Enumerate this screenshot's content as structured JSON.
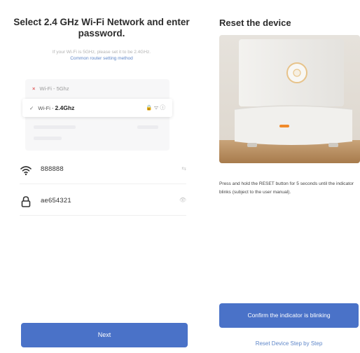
{
  "left": {
    "title": "Select 2.4 GHz Wi-Fi Network and enter password.",
    "hint": "If your Wi-Fi is 5GHz, please set it to be 2.4GHz.",
    "hint_link": "Common router setting method",
    "wifi_list": {
      "row_5g_mark": "×",
      "row_5g_label": "Wi-Fi - 5Ghz",
      "row_24_mark": "✓",
      "row_24_prefix": "Wi-Fi - ",
      "row_24_band": "2.4Ghz",
      "row_24_status": "🔒 ᯤ ⓘ"
    },
    "ssid": {
      "value": "888888",
      "icon": "wifi-icon",
      "accessory": "⇆"
    },
    "password": {
      "value": "ae654321",
      "icon": "lock-icon",
      "accessory": "👁"
    },
    "next_label": "Next"
  },
  "right": {
    "title": "Reset the device",
    "photo_icon": "device-photo",
    "description": "Press and hold the RESET button for 5 seconds until the indicator blinks (subject to the user manual).",
    "confirm_label": "Confirm the indicator is blinking",
    "reset_link": "Reset Device Step by Step"
  },
  "colors": {
    "accent": "#4a72c8",
    "link": "#5f87c9",
    "indicator": "#f08a2a"
  }
}
